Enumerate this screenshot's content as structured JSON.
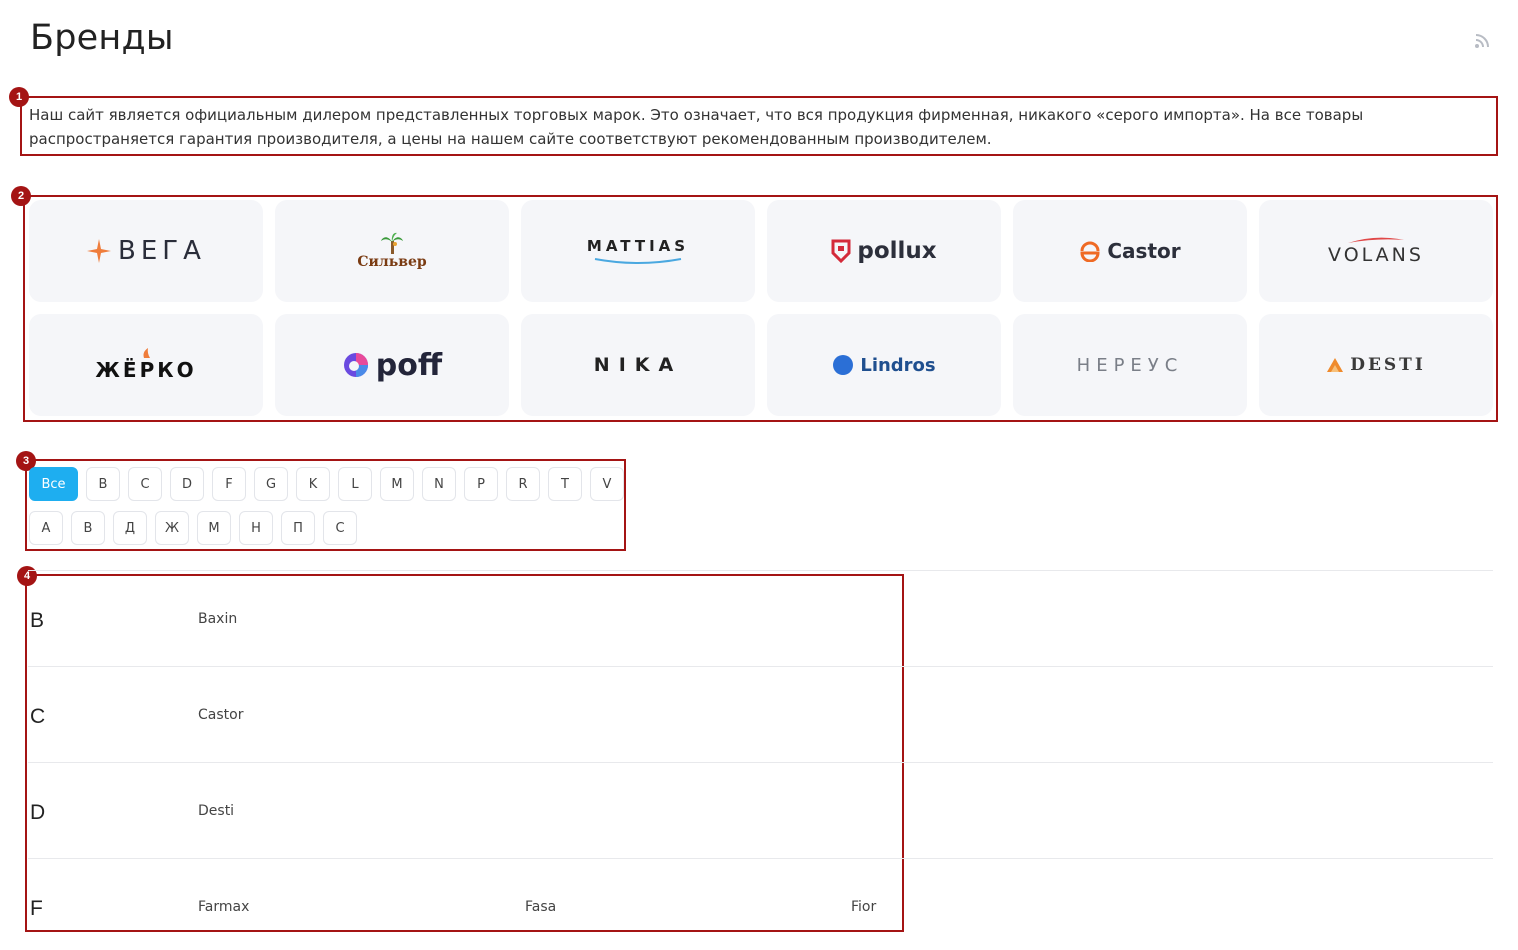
{
  "page": {
    "title": "Бренды",
    "intro": "Наш сайт является официальным дилером представленных торговых марок. Это означает, что вся продукция фирменная, никакого «серого импорта». На все товары распространяется гарантия производителя, а цены на нашем сайте соответствуют рекомендованным производителем."
  },
  "annotations": [
    "1",
    "2",
    "3",
    "4"
  ],
  "brands": [
    {
      "name": "ВЕГА",
      "icon": "star-icon"
    },
    {
      "name": "Сильвер",
      "icon": "palm-icon"
    },
    {
      "name": "MATTIAS",
      "icon": "wave-icon"
    },
    {
      "name": "pollux",
      "icon": "shield-icon"
    },
    {
      "name": "Castor",
      "icon": "pot-icon"
    },
    {
      "name": "VOLANS",
      "icon": "swoosh-icon"
    },
    {
      "name": "ЖЁРКО",
      "icon": "flame-icon"
    },
    {
      "name": "poff",
      "icon": "swirl-icon"
    },
    {
      "name": "NIKA",
      "icon": ""
    },
    {
      "name": "Lindros",
      "icon": "leaf-icon"
    },
    {
      "name": "НЕРЕУС",
      "icon": ""
    },
    {
      "name": "DESTI",
      "icon": "mountain-icon"
    }
  ],
  "filters": {
    "latin": [
      "Все",
      "B",
      "C",
      "D",
      "F",
      "G",
      "K",
      "L",
      "M",
      "N",
      "P",
      "R",
      "T",
      "V"
    ],
    "cyrillic": [
      "А",
      "В",
      "Д",
      "Ж",
      "М",
      "Н",
      "П",
      "С"
    ],
    "active": "Все"
  },
  "letter_groups": [
    {
      "letter": "B",
      "brands": [
        "Baxin"
      ]
    },
    {
      "letter": "C",
      "brands": [
        "Castor"
      ]
    },
    {
      "letter": "D",
      "brands": [
        "Desti"
      ]
    },
    {
      "letter": "F",
      "brands": [
        "Farmax",
        "Fasa",
        "Fior"
      ]
    }
  ],
  "colors": {
    "accent": "#1eaef0",
    "annotation": "#a41414",
    "card_bg": "#f5f6f9"
  }
}
